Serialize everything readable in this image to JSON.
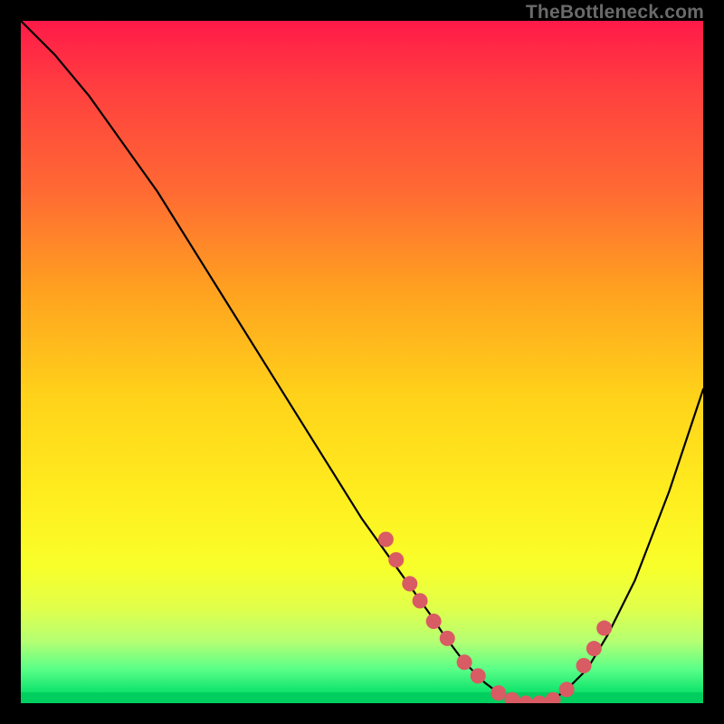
{
  "branding": "TheBottleneck.com",
  "colors": {
    "curve": "#000000",
    "marker_fill": "#d95b63",
    "marker_stroke": "#c04a52",
    "background_black": "#000000"
  },
  "chart_data": {
    "type": "line",
    "title": "",
    "xlabel": "",
    "ylabel": "",
    "xlim": [
      0,
      100
    ],
    "ylim": [
      0,
      100
    ],
    "series": [
      {
        "name": "bottleneck-curve",
        "x": [
          0,
          5,
          10,
          15,
          20,
          25,
          30,
          35,
          40,
          45,
          50,
          55,
          60,
          62,
          65,
          68,
          70,
          72,
          75,
          78,
          80,
          83,
          86,
          90,
          95,
          100
        ],
        "y": [
          100,
          95,
          89,
          82,
          75,
          67,
          59,
          51,
          43,
          35,
          27,
          20,
          13,
          10,
          6,
          3,
          1.5,
          0.5,
          0,
          0.5,
          2,
          5,
          10,
          18,
          31,
          46
        ]
      }
    ],
    "markers": {
      "name": "highlight-points",
      "x": [
        53.5,
        55,
        57,
        58.5,
        60.5,
        62.5,
        65,
        67,
        70,
        72,
        74,
        76,
        78,
        80,
        82.5,
        84,
        85.5
      ],
      "y": [
        24,
        21,
        17.5,
        15,
        12,
        9.5,
        6,
        4,
        1.5,
        0.5,
        0,
        0,
        0.5,
        2,
        5.5,
        8,
        11
      ]
    }
  }
}
